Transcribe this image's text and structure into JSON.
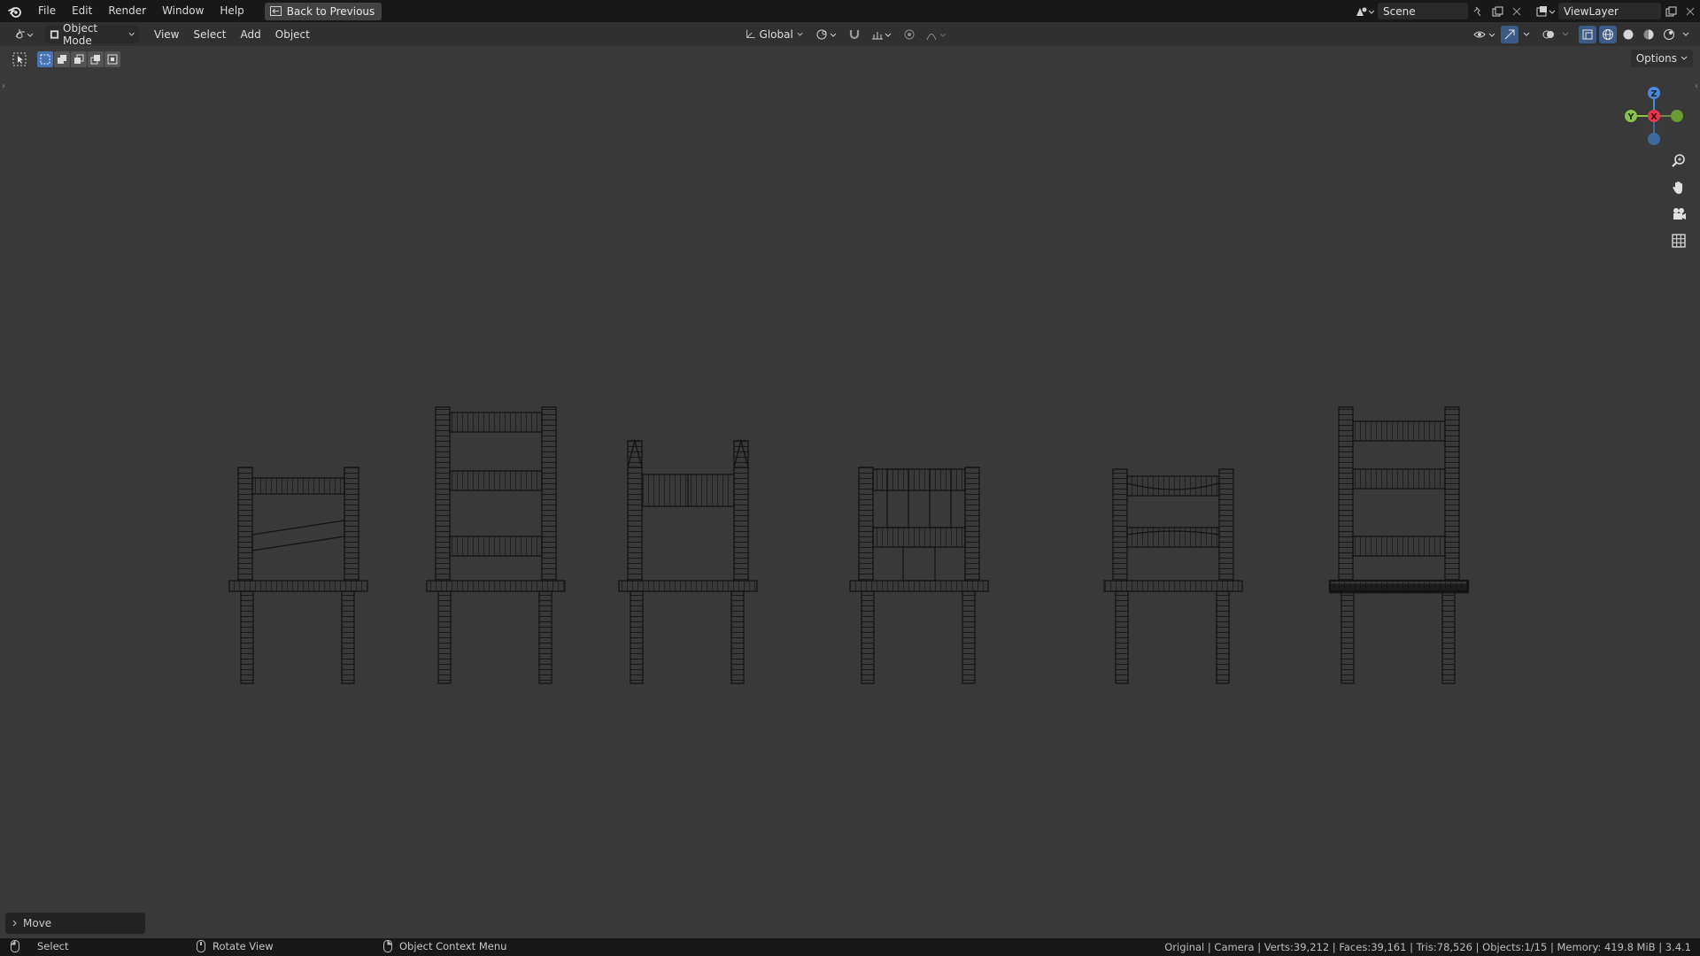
{
  "topbar": {
    "menus": [
      "File",
      "Edit",
      "Render",
      "Window",
      "Help"
    ],
    "back_label": "Back to Previous",
    "scene": "Scene",
    "view_layer": "ViewLayer"
  },
  "header": {
    "mode": "Object Mode",
    "menus": [
      "View",
      "Select",
      "Add",
      "Object"
    ],
    "transform_orientation": "Global"
  },
  "viewport": {
    "options_label": "Options",
    "gizmo": {
      "x_label": "X",
      "y_label": "Y",
      "z_label": "Z"
    },
    "last_operator": "Move"
  },
  "statusbar": {
    "select": "Select",
    "rotate": "Rotate View",
    "context": "Object Context Menu",
    "stats": "Original | Camera | Verts:39,212 | Faces:39,161 | Tris:78,526 | Objects:1/15 | Memory: 419.8 MiB | 3.4.1"
  },
  "colors": {
    "accent": "#4772b3",
    "axis_x": "#e8374f",
    "axis_y": "#8bc34a",
    "axis_z": "#4a89dc"
  }
}
